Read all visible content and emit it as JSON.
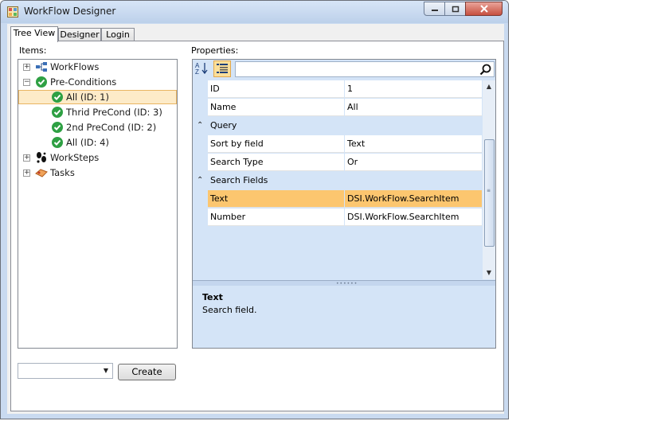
{
  "window": {
    "title": "WorkFlow Designer",
    "minimize_icon": "minimize-icon",
    "maximize_icon": "maximize-icon",
    "close_icon": "close-icon"
  },
  "tabs": [
    {
      "label": "Tree View",
      "active": true
    },
    {
      "label": "Designer",
      "active": false
    },
    {
      "label": "Login",
      "active": false
    }
  ],
  "items_panel": {
    "label": "Items:",
    "tree": [
      {
        "label": "WorkFlows",
        "expander": "+",
        "icon": "workflow-icon",
        "level": 0
      },
      {
        "label": "Pre-Conditions",
        "expander": "−",
        "icon": "check-icon",
        "level": 0
      },
      {
        "label": "All (ID: 1)",
        "icon": "check-icon",
        "level": 1,
        "selected": true
      },
      {
        "label": "Thrid PreCond (ID: 3)",
        "icon": "check-icon",
        "level": 1
      },
      {
        "label": "2nd PreCond (ID: 2)",
        "icon": "check-icon",
        "level": 1
      },
      {
        "label": "All (ID: 4)",
        "icon": "check-icon",
        "level": 1
      },
      {
        "label": "WorkSteps",
        "expander": "+",
        "icon": "footsteps-icon",
        "level": 0
      },
      {
        "label": "Tasks",
        "expander": "+",
        "icon": "tasks-icon",
        "level": 0
      }
    ]
  },
  "create": {
    "combo_value": "",
    "button_label": "Create"
  },
  "properties_panel": {
    "label": "Properties:",
    "search_placeholder": "",
    "rows": [
      {
        "kind": "prop",
        "name": "ID",
        "value": "1"
      },
      {
        "kind": "prop",
        "name": "Name",
        "value": "All"
      },
      {
        "kind": "category",
        "name": "Query"
      },
      {
        "kind": "prop",
        "name": "Sort by field",
        "value": "Text"
      },
      {
        "kind": "prop",
        "name": "Search Type",
        "value": "Or"
      },
      {
        "kind": "category",
        "name": "Search Fields"
      },
      {
        "kind": "prop",
        "name": "Text",
        "value": "DSI.WorkFlow.SearchItem",
        "selected": true
      },
      {
        "kind": "prop",
        "name": "Number",
        "value": "DSI.WorkFlow.SearchItem"
      }
    ],
    "help_title": "Text",
    "help_description": "Search field."
  },
  "colors": {
    "selection": "#fcc66f",
    "panel_bg": "#d4e4f7",
    "check_green": "#2ea043"
  }
}
